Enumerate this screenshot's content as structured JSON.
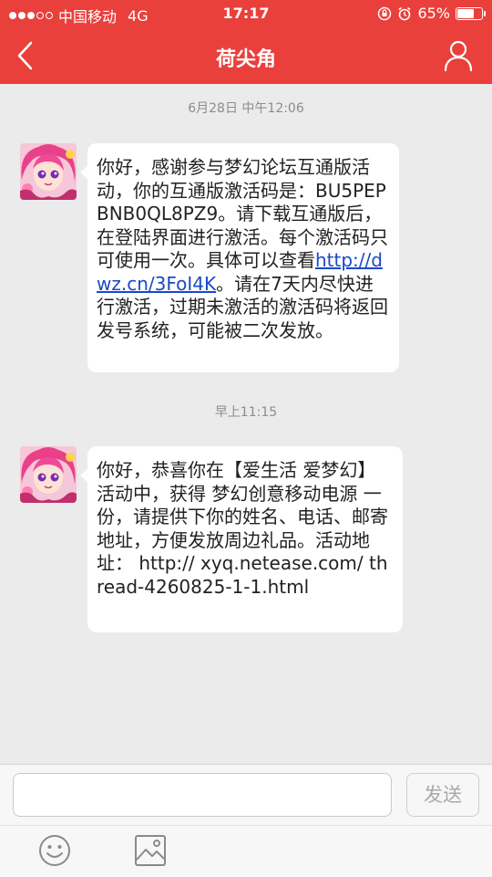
{
  "status_bar": {
    "carrier": "中国移动",
    "network": "4G",
    "time": "17:17",
    "battery_percent": "65%",
    "battery_level": 0.65,
    "signal_bars_filled": 3,
    "signal_bars_total": 5
  },
  "nav": {
    "title": "荷尖角",
    "back_icon": "chevron-left-icon",
    "contact_icon": "person-icon"
  },
  "messages": [
    {
      "timestamp": "6月28日 中午12:06",
      "text_before_link": "你好，感谢参与梦幻论坛互通版活动，你的互通版激活码是：BU5PEPBNB0QL8PZ9。请下载互通版后，在登陆界面进行激活。每个激活码只可使用一次。具体可以查看",
      "link": "http://dwz.cn/3FoI4K",
      "text_after_link": "。请在7天内尽快进行激活，过期未激活的激活码将返回发号系统，可能被二次发放。"
    },
    {
      "timestamp": "早上11:15",
      "text": "你好，恭喜你在【爱生活 爱梦幻】活动中，获得 梦幻创意移动电源 一份，请提供下你的姓名、电话、邮寄地址，方便发放周边礼品。活动地址： http:// xyq.netease.com/ thread-4260825-1-1.html"
    }
  ],
  "composer": {
    "input_value": "",
    "send_label": "发送",
    "emoji_icon": "emoji-icon",
    "image_icon": "image-icon"
  },
  "colors": {
    "accent": "#e9403c",
    "link": "#1a49c8",
    "background": "#ebebeb"
  }
}
